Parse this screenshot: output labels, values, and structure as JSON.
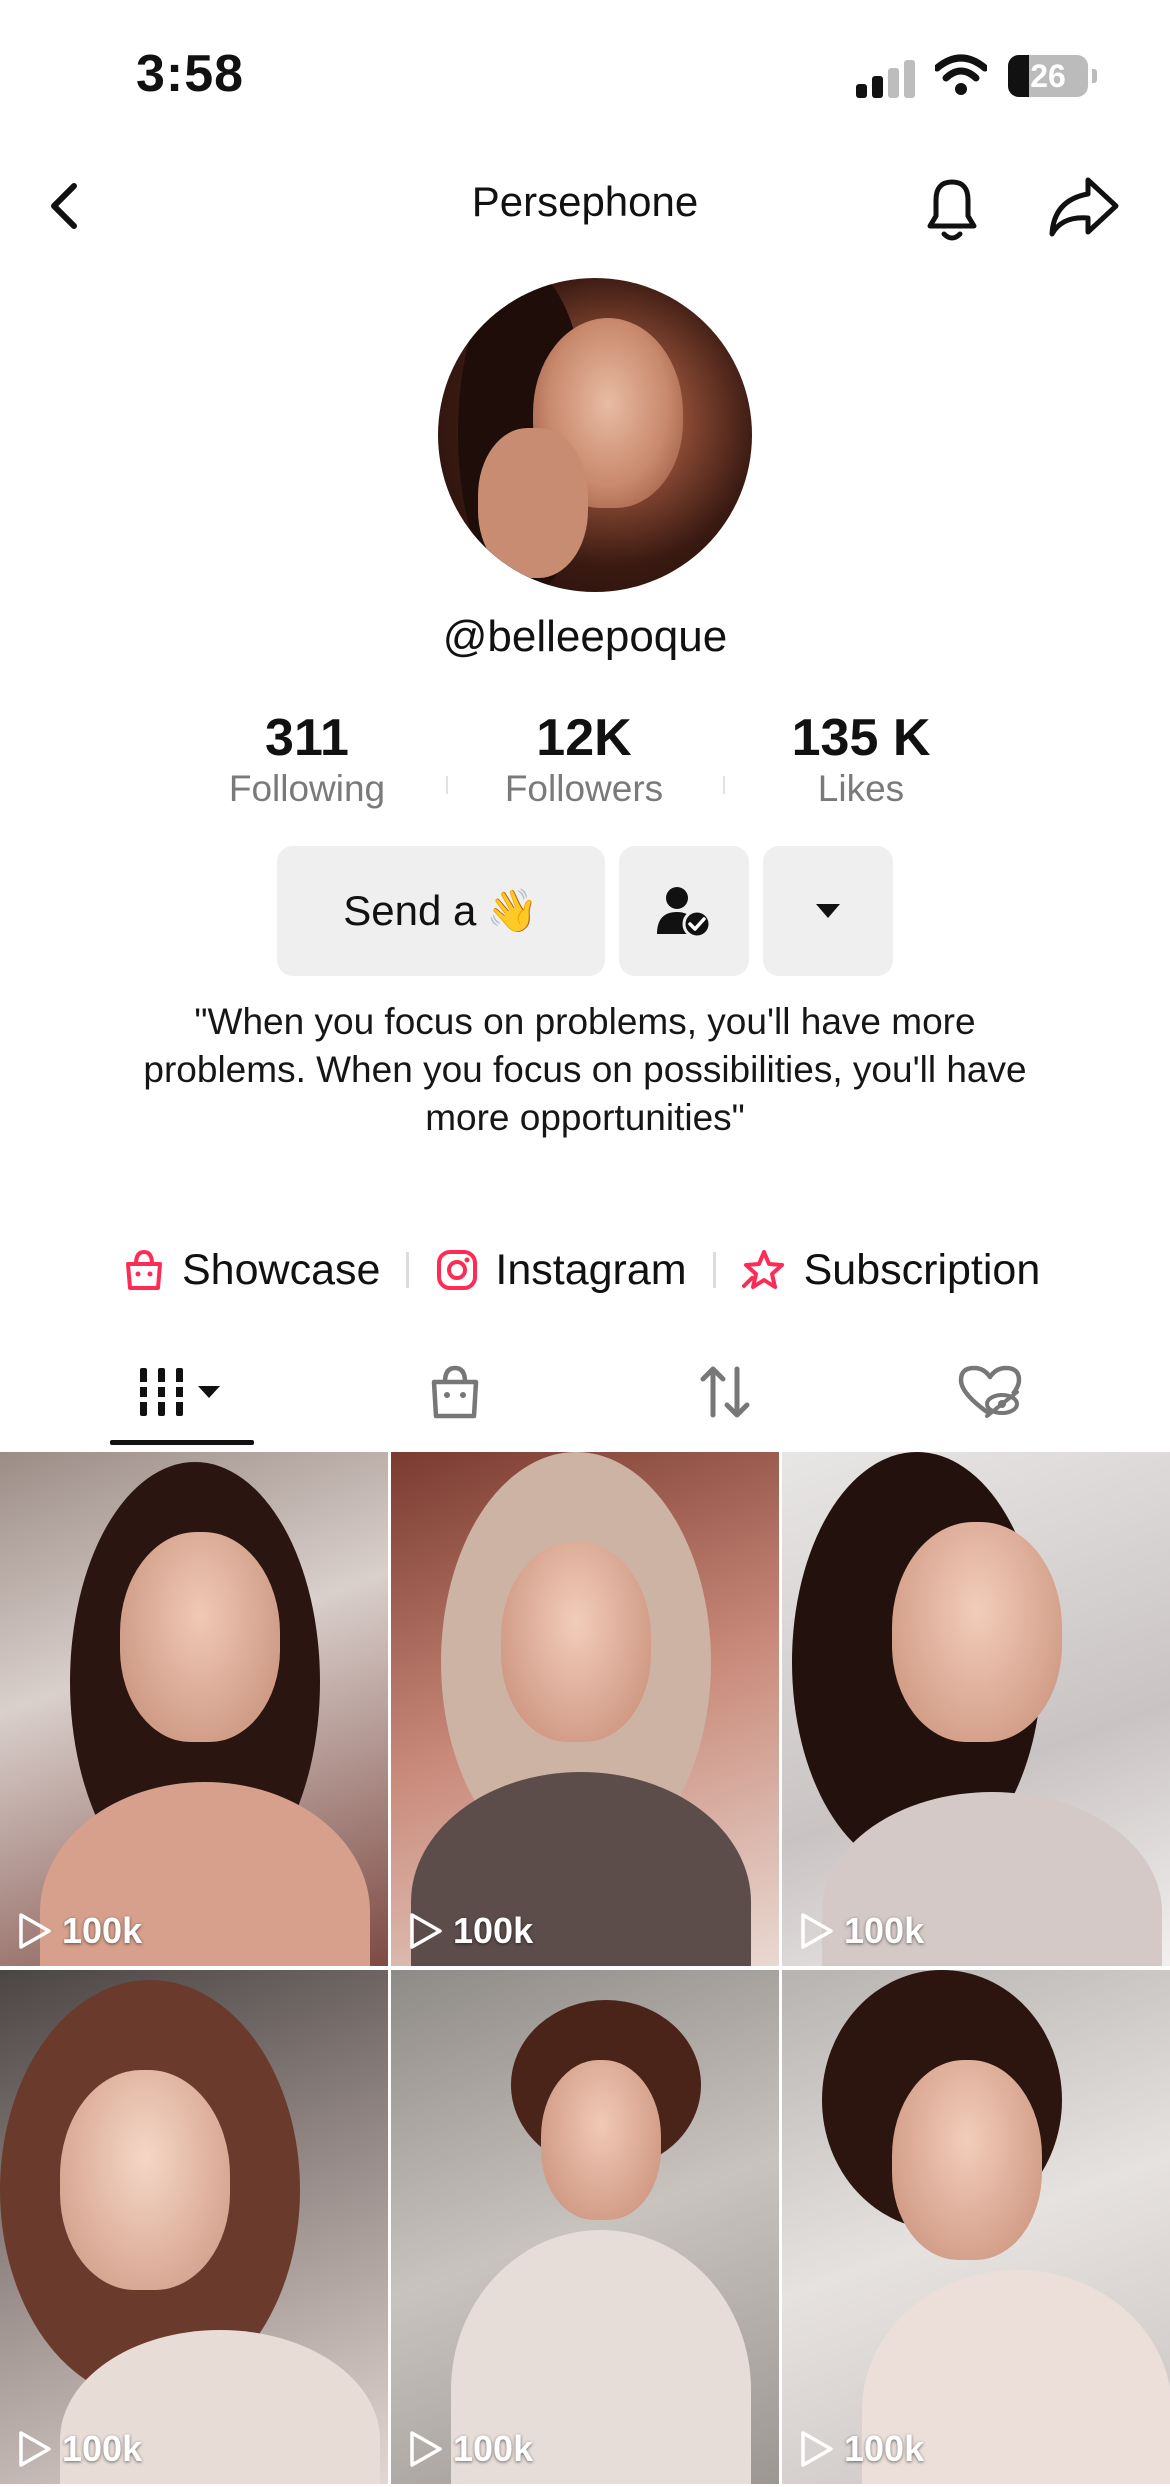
{
  "status_bar": {
    "time": "3:58",
    "battery": "26",
    "battery_level": 0.26
  },
  "header": {
    "title": "Persephone"
  },
  "profile": {
    "handle": "@belleepoque",
    "stats": [
      {
        "value": "311",
        "label": "Following"
      },
      {
        "value": "12K",
        "label": "Followers"
      },
      {
        "value": "135 K",
        "label": "Likes"
      }
    ],
    "send_button": "Send a",
    "send_emoji": "👋",
    "bio": "\"When you focus on problems, you'll have more problems. When you focus on possibilities, you'll have more opportunities\""
  },
  "links": [
    {
      "label": "Showcase",
      "icon": "shopping-bag-icon"
    },
    {
      "label": "Instagram",
      "icon": "instagram-icon"
    },
    {
      "label": "Subscription",
      "icon": "subscription-star-icon"
    }
  ],
  "tabs": [
    {
      "name": "videos",
      "icon": "grid-bars-icon",
      "selected": true
    },
    {
      "name": "shop",
      "icon": "bag-icon"
    },
    {
      "name": "reposts",
      "icon": "repost-icon"
    },
    {
      "name": "liked",
      "icon": "hidden-heart-icon"
    }
  ],
  "videos": [
    {
      "views": "100k"
    },
    {
      "views": "100k"
    },
    {
      "views": "100k"
    },
    {
      "views": "100k"
    },
    {
      "views": "100k"
    },
    {
      "views": "100k"
    }
  ],
  "colors": {
    "accent": "#fe2c55",
    "button_bg": "#efeff0",
    "muted_text": "#7a7a7a"
  }
}
